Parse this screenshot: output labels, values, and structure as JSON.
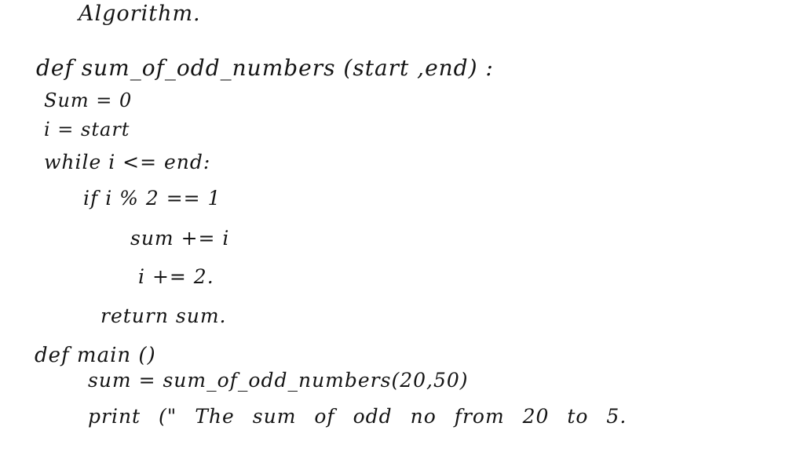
{
  "document": {
    "title": "Algorithm.",
    "lines": [
      "def sum_of_odd_numbers (start ,end) :",
      "Sum = 0",
      "i = start",
      "while i <= end:",
      "if i % 2 == 1",
      "sum += i",
      "i += 2.",
      "return sum.",
      "def main ()",
      "sum = sum_of_odd_numbers(20,50)",
      "print (\" The sum of odd no from 20 to 5."
    ]
  }
}
